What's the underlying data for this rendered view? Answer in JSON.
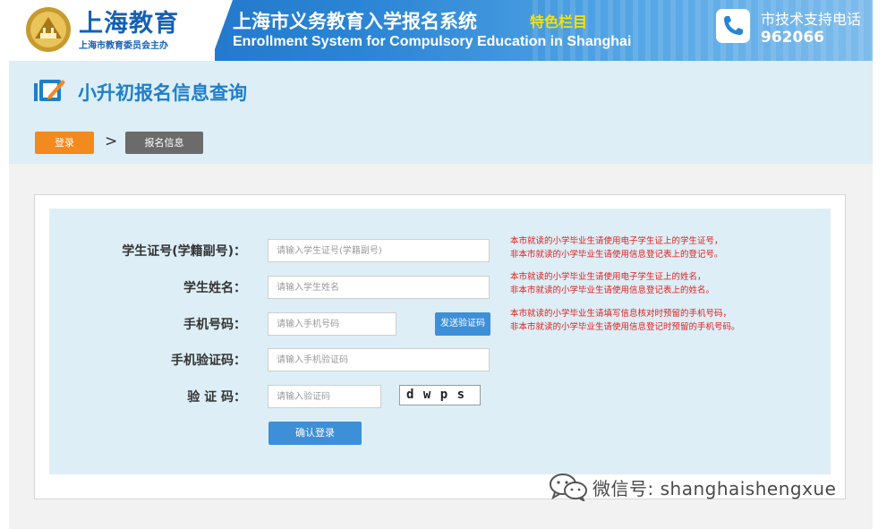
{
  "header": {
    "logo_title": "上海教育",
    "logo_subtitle": "上海市教育委员会主办",
    "system_title_cn": "上海市义务教育入学报名系统",
    "system_tag": "特色栏目",
    "system_title_en": "Enrollment System for Compulsory Education in Shanghai",
    "support_label": "市技术支持电话",
    "support_number": "962066",
    "icons": [
      "emblem-logo",
      "phone-icon"
    ],
    "colors": {
      "banner_blue": "#1b6bbf",
      "tag_yellow": "#f6e200",
      "logo_blue": "#1560b5"
    }
  },
  "page": {
    "title": "小升初报名信息查询",
    "title_icon": "edit-icon",
    "title_color": "#1f7fc8"
  },
  "breadcrumb": {
    "step1": "登录",
    "separator": ">",
    "step2": "报名信息",
    "colors": {
      "active": "#f28a1e",
      "inactive": "#6b6b6b"
    }
  },
  "form": {
    "student_id": {
      "label": "学生证号(学籍副号)：",
      "placeholder": "请输入学生证号(学籍副号)"
    },
    "student_name": {
      "label": "学生姓名：",
      "placeholder": "请输入学生姓名"
    },
    "phone": {
      "label": "手机号码：",
      "placeholder": "请输入手机号码",
      "button": "发送验证码"
    },
    "sms_code": {
      "label": "手机验证码：",
      "placeholder": "请输入手机验证码"
    },
    "captcha": {
      "label": "验 证 码：",
      "placeholder": "请输入验证码",
      "image_text": "d w p s"
    },
    "submit": "确认登录"
  },
  "notes": {
    "student_id": [
      "本市就读的小学毕业生请使用电子学生证上的学生证号，",
      "非本市就读的小学毕业生请使用信息登记表上的登记号。"
    ],
    "student_name": [
      "本市就读的小学毕业生请使用电子学生证上的姓名，",
      "非本市就读的小学毕业生请使用信息登记表上的姓名。"
    ],
    "phone": [
      "本市就读的小学毕业生请填写信息核对时预留的手机号码，",
      "非本市就读的小学毕业生请使用信息登记时预留的手机号码。"
    ],
    "color": "#e02020"
  },
  "watermark": {
    "icon": "wechat-icon",
    "text": "微信号: shanghaishengxue"
  }
}
